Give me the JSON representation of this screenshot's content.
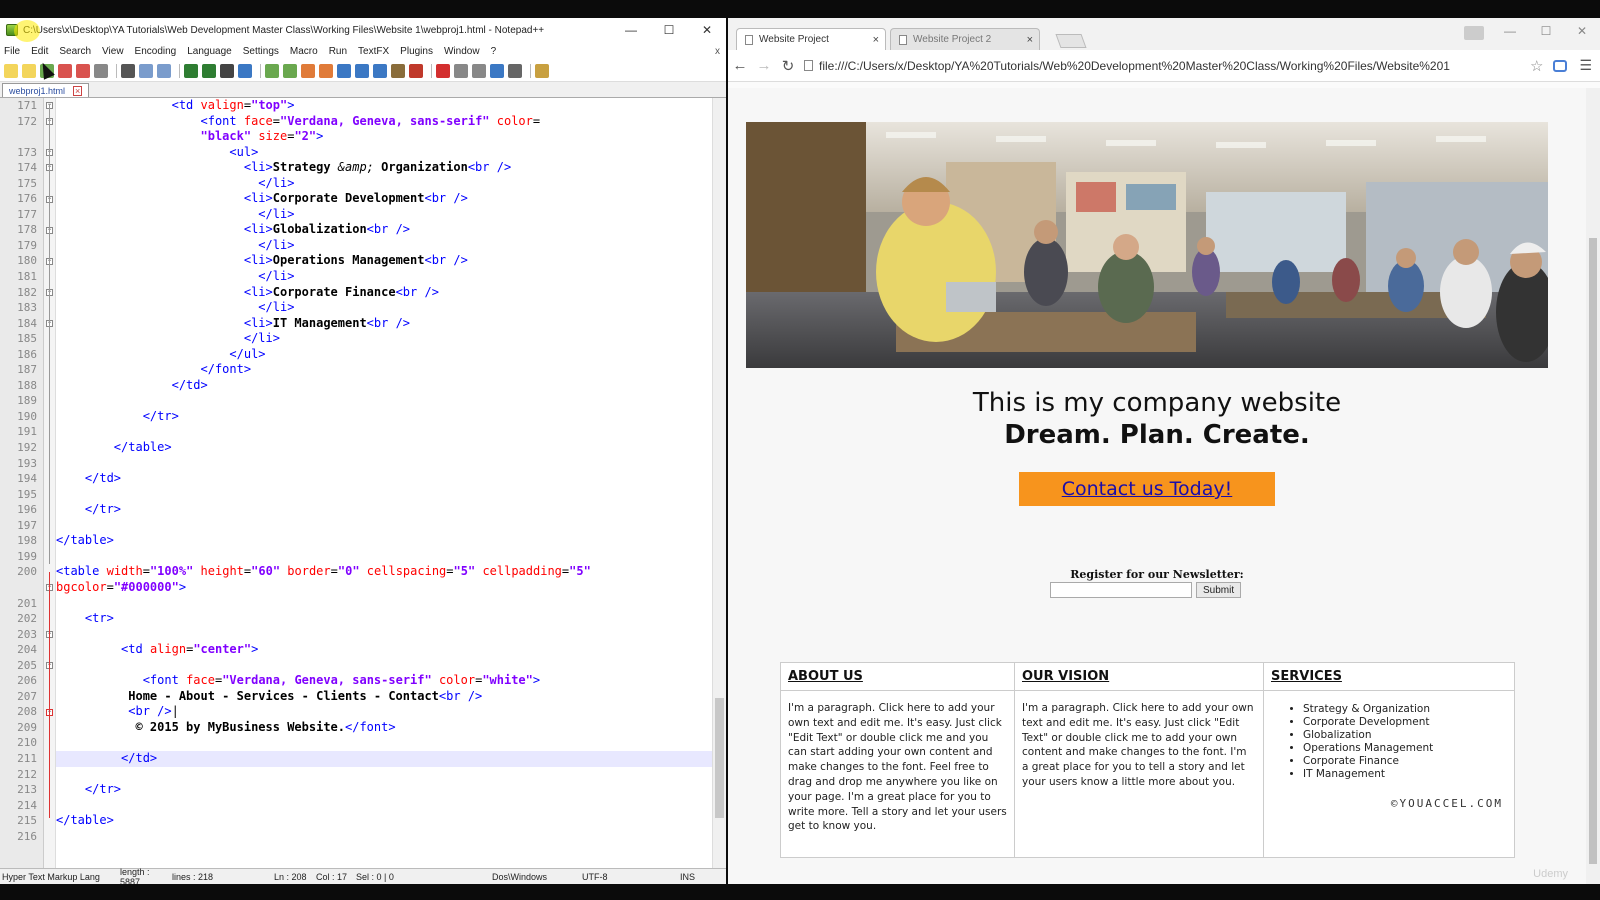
{
  "notepad": {
    "title": "C:\\Users\\x\\Desktop\\YA Tutorials\\Web Development Master Class\\Working Files\\Website 1\\webproj1.html - Notepad++",
    "menu": [
      "File",
      "Edit",
      "Search",
      "View",
      "Encoding",
      "Language",
      "Settings",
      "Macro",
      "Run",
      "TextFX",
      "Plugins",
      "Window",
      "?"
    ],
    "menu_close": "x",
    "tab_label": "webproj1.html",
    "lines": [
      {
        "n": "171",
        "html": "                <span class='tag'>&lt;td</span> <span class='att'>valign</span>=<span class='val'>\"top\"</span><span class='tag'>&gt;</span>"
      },
      {
        "n": "172",
        "html": "                    <span class='tag'>&lt;font</span> <span class='att'>face</span>=<span class='val'>\"Verdana, Geneva, sans-serif\"</span> <span class='att'>color</span>="
      },
      {
        "n": "",
        "html": "                    <span class='val'>\"black\"</span> <span class='att'>size</span>=<span class='val'>\"2\"</span><span class='tag'>&gt;</span>"
      },
      {
        "n": "173",
        "html": "                        <span class='tag'>&lt;ul&gt;</span>"
      },
      {
        "n": "174",
        "html": "                          <span class='tag'>&lt;li&gt;</span><span class='txt'>Strategy </span><i>&amp;amp;</i><span class='txt'> Organization</span><span class='tag'>&lt;br /&gt;</span>"
      },
      {
        "n": "175",
        "html": "                            <span class='tag'>&lt;/li&gt;</span>"
      },
      {
        "n": "176",
        "html": "                          <span class='tag'>&lt;li&gt;</span><span class='txt'>Corporate Development</span><span class='tag'>&lt;br /&gt;</span>"
      },
      {
        "n": "177",
        "html": "                            <span class='tag'>&lt;/li&gt;</span>"
      },
      {
        "n": "178",
        "html": "                          <span class='tag'>&lt;li&gt;</span><span class='txt'>Globalization</span><span class='tag'>&lt;br /&gt;</span>"
      },
      {
        "n": "179",
        "html": "                            <span class='tag'>&lt;/li&gt;</span>"
      },
      {
        "n": "180",
        "html": "                          <span class='tag'>&lt;li&gt;</span><span class='txt'>Operations Management</span><span class='tag'>&lt;br /&gt;</span>"
      },
      {
        "n": "181",
        "html": "                            <span class='tag'>&lt;/li&gt;</span>"
      },
      {
        "n": "182",
        "html": "                          <span class='tag'>&lt;li&gt;</span><span class='txt'>Corporate Finance</span><span class='tag'>&lt;br /&gt;</span>"
      },
      {
        "n": "183",
        "html": "                            <span class='tag'>&lt;/li&gt;</span>"
      },
      {
        "n": "184",
        "html": "                          <span class='tag'>&lt;li&gt;</span><span class='txt'>IT Management</span><span class='tag'>&lt;br /&gt;</span>"
      },
      {
        "n": "185",
        "html": "                          <span class='tag'>&lt;/li&gt;</span>"
      },
      {
        "n": "186",
        "html": "                        <span class='tag'>&lt;/ul&gt;</span>"
      },
      {
        "n": "187",
        "html": "                    <span class='tag'>&lt;/font&gt;</span>"
      },
      {
        "n": "188",
        "html": "                <span class='tag'>&lt;/td&gt;</span>"
      },
      {
        "n": "189",
        "html": ""
      },
      {
        "n": "190",
        "html": "            <span class='tag'>&lt;/tr&gt;</span>"
      },
      {
        "n": "191",
        "html": ""
      },
      {
        "n": "192",
        "html": "        <span class='tag'>&lt;/table&gt;</span>"
      },
      {
        "n": "193",
        "html": ""
      },
      {
        "n": "194",
        "html": "    <span class='tag'>&lt;/td&gt;</span>"
      },
      {
        "n": "195",
        "html": ""
      },
      {
        "n": "196",
        "html": "    <span class='tag'>&lt;/tr&gt;</span>"
      },
      {
        "n": "197",
        "html": ""
      },
      {
        "n": "198",
        "html": "<span class='tag'>&lt;/table&gt;</span>"
      },
      {
        "n": "199",
        "html": ""
      },
      {
        "n": "200",
        "html": "<span class='tag'>&lt;table</span> <span class='att'>width</span>=<span class='val'>\"100%\"</span> <span class='att'>height</span>=<span class='val'>\"60\"</span> <span class='att'>border</span>=<span class='val'>\"0\"</span> <span class='att'>cellspacing</span>=<span class='val'>\"5\"</span> <span class='att'>cellpadding</span>=<span class='val'>\"5\"</span>"
      },
      {
        "n": "",
        "html": "<span class='att'>bgcolor</span>=<span class='val'>\"#000000\"</span><span class='tag'>&gt;</span>"
      },
      {
        "n": "201",
        "html": ""
      },
      {
        "n": "202",
        "html": "    <span class='tag'>&lt;tr&gt;</span>"
      },
      {
        "n": "203",
        "html": ""
      },
      {
        "n": "204",
        "html": "         <span class='tag'>&lt;td</span> <span class='att'>align</span>=<span class='val'>\"center\"</span><span class='tag'>&gt;</span>"
      },
      {
        "n": "205",
        "html": ""
      },
      {
        "n": "206",
        "html": "            <span class='tag'>&lt;font</span> <span class='att'>face</span>=<span class='val'>\"Verdana, Geneva, sans-serif\"</span> <span class='att'>color</span>=<span class='val'>\"white\"</span><span class='tag'>&gt;</span>"
      },
      {
        "n": "207",
        "html": "          <span class='txt'>Home - About - Services - Clients - Contact</span><span class='tag'>&lt;br /&gt;</span>"
      },
      {
        "n": "208",
        "html": "          <span class='tag'>&lt;br /&gt;</span>|"
      },
      {
        "n": "209",
        "html": "           <span class='txt'>© 2015 by MyBusiness Website.</span><span class='tag'>&lt;/font&gt;</span>"
      },
      {
        "n": "210",
        "html": ""
      },
      {
        "n": "211",
        "html": "         <span class='tag'>&lt;/td&gt;</span>"
      },
      {
        "n": "212",
        "html": ""
      },
      {
        "n": "213",
        "html": "    <span class='tag'>&lt;/tr&gt;</span>"
      },
      {
        "n": "214",
        "html": ""
      },
      {
        "n": "215",
        "html": "<span class='tag'>&lt;/table&gt;</span>"
      },
      {
        "n": "216",
        "html": ""
      }
    ],
    "status": {
      "type": "Hyper Text Markup Lang",
      "length": "length : 5887",
      "lines": "lines : 218",
      "ln": "Ln : 208",
      "col": "Col : 17",
      "sel": "Sel : 0 | 0",
      "eol": "Dos\\Windows",
      "enc": "UTF-8",
      "mode": "INS"
    }
  },
  "browser": {
    "tabs": [
      {
        "label": "Website Project",
        "close": "×"
      },
      {
        "label": "Website Project 2",
        "close": "×"
      }
    ],
    "url": "file:///C:/Users/x/Desktop/YA%20Tutorials/Web%20Development%20Master%20Class/Working%20Files/Website%201",
    "page": {
      "heading": "This is my company website",
      "tagline": "Dream. Plan. Create.",
      "cta": "Contact us Today!",
      "newsletter_label": "Register for our Newsletter:",
      "submit": "Submit",
      "columns": [
        {
          "title": "ABOUT US",
          "text": "I'm a paragraph. Click here to add your own text and edit me. It's easy. Just click \"Edit Text\" or double click me and you can start adding your own content and make changes to the font. Feel free to drag and drop me anywhere you like on your page. I'm a great place for you to write more. Tell a story and let your users get to know you."
        },
        {
          "title": "OUR VISION",
          "text": "I'm a paragraph. Click here to add your own text and edit me. It's easy. Just click \"Edit Text\" or double click me to add your own content and make changes to the font. I'm a great place for you to tell a story and let your users know a little more about you."
        },
        {
          "title": "SERVICES",
          "items": [
            "Strategy & Organization",
            "Corporate Development",
            "Globalization",
            "Operations Management",
            "Corporate Finance",
            "IT Management"
          ]
        }
      ],
      "copyright": "©YOUACCEL.COM"
    },
    "watermark": "Udemy"
  },
  "colors": {
    "cta_bg": "#f7941d",
    "link": "#1a0dab",
    "tag": "#0000ff",
    "attr": "#ff0000",
    "value": "#8000ff"
  }
}
